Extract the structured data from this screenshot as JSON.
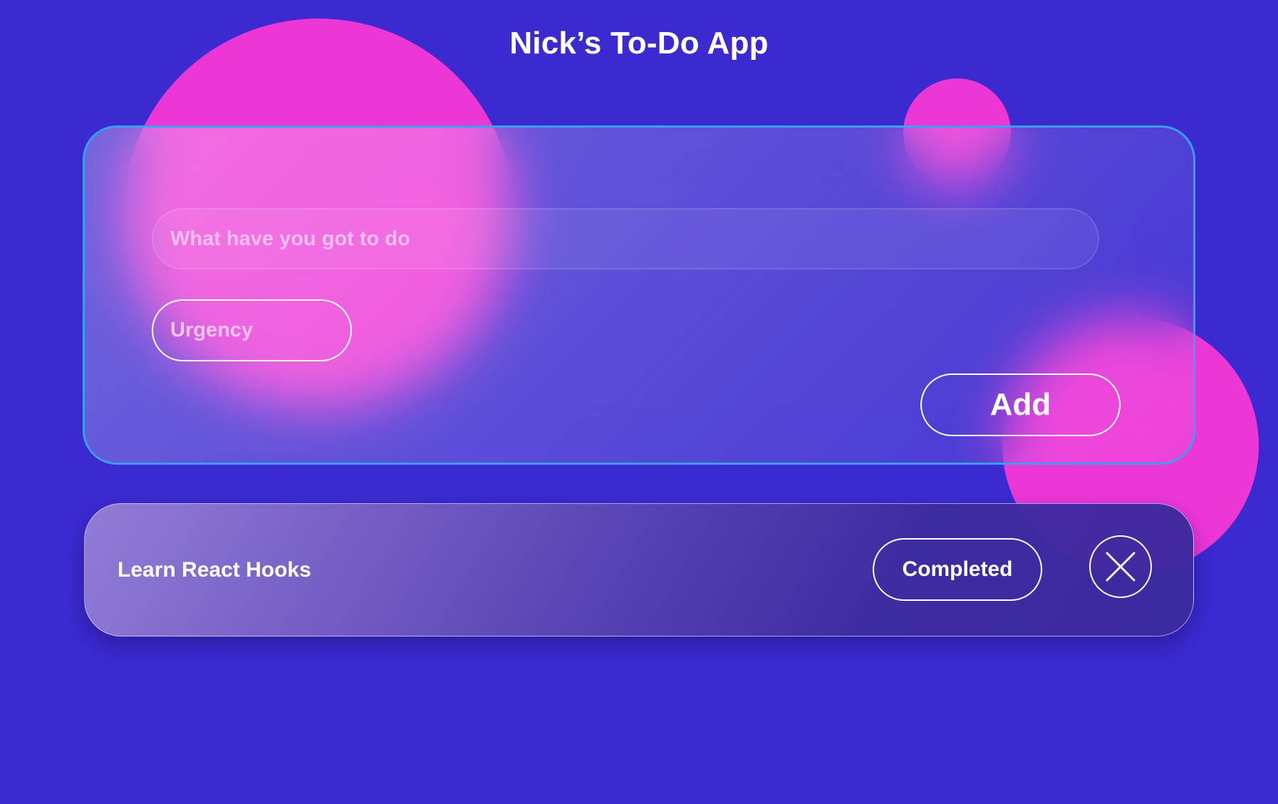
{
  "app": {
    "title": "Nick’s To-Do App"
  },
  "form": {
    "task_placeholder": "What have you got to do",
    "task_value": "",
    "urgency_label": "Urgency",
    "add_label": "Add"
  },
  "todos": [
    {
      "text": "Learn React Hooks",
      "status_label": "Completed",
      "delete_icon": "close-icon"
    }
  ],
  "colors": {
    "background": "#3b2ad0",
    "blob": "#ec37d7",
    "card_border": "#3c9ef0",
    "text": "#ffffff"
  }
}
